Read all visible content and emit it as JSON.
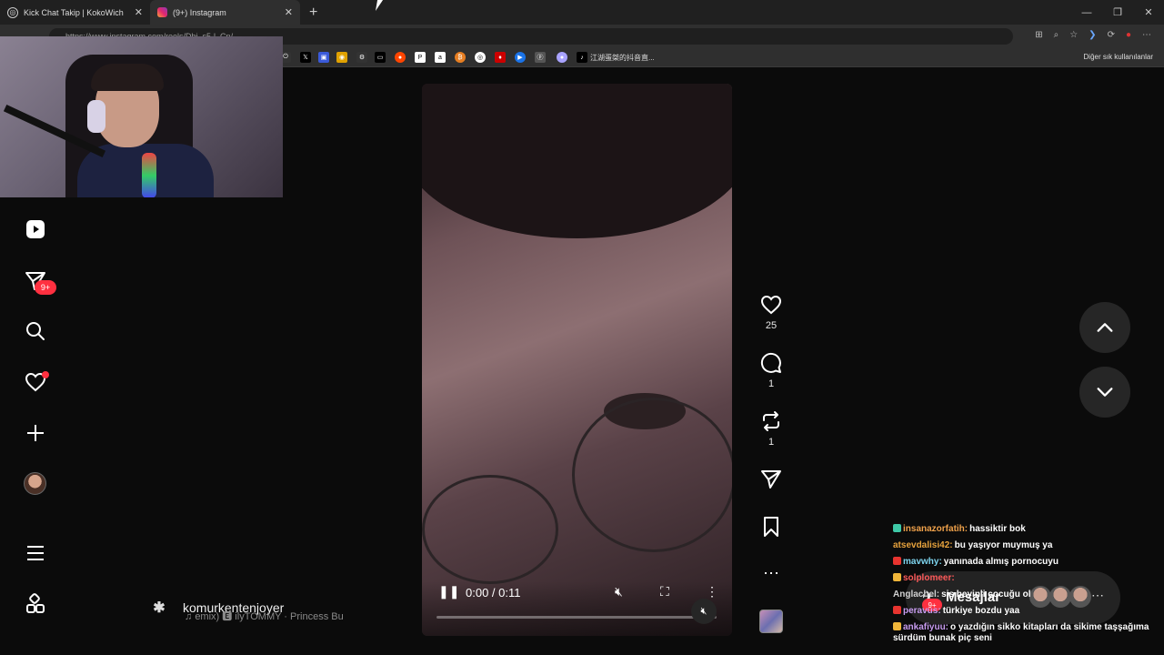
{
  "browser": {
    "tabs": [
      {
        "label": "Kick Chat Takip | KokoWich",
        "active": false
      },
      {
        "label": "(9+) Instagram",
        "active": true
      }
    ],
    "new_tab_label": "+",
    "url": "https://www.instagram.com/reels/Dhi_s5-l_Cn/",
    "bookmark_folder_text": "江湖蛋桀的抖音直...",
    "other_bookmarks": "Diğer sık kullanılanlar"
  },
  "sidebar": {
    "notification_badge": "9+",
    "items": [
      "reels",
      "messages",
      "search",
      "notifications",
      "create",
      "profile",
      "more",
      "also-from-meta"
    ]
  },
  "reel": {
    "author": "komurkentenjoyer",
    "audio": "emix) 🅴 ilyTOMMY · Princess Bu",
    "time": "0:00 / 0:11",
    "progress": 0.0,
    "likes": "25",
    "comments": "1",
    "reposts": "1"
  },
  "chat": {
    "messages": [
      {
        "user": "insanazorfatih:",
        "text": "hassiktir bok",
        "color": "#f0a24b",
        "icon": "#3ec9a7"
      },
      {
        "user": "atsevdalisi42:",
        "text": "bu yaşıyor muymuş ya",
        "color": "#e8a33d",
        "icon": ""
      },
      {
        "user": "mavwhy:",
        "text": "yanınada almış pornocuyu",
        "color": "#7fd6f0",
        "icon": "#e8342f"
      },
      {
        "user": "solplomeer:",
        "text": "",
        "color": "#ff5a5a",
        "icon": "#f0b63a"
      },
      {
        "user": "Anglachel:",
        "text": "sis beyinli çocuğu ol",
        "color": "#d0d0d0",
        "icon": ""
      },
      {
        "user": "peravus:",
        "text": "türkiye bozdu yaa",
        "color": "#c89cf0",
        "icon": "#e8342f"
      },
      {
        "user": "ankafiyuu:",
        "text": "o yazdığın sikko kitapları da sikime taşşağıma sürdüm bunak piç seni",
        "color": "#c89cf0",
        "icon": "#f0b63a"
      }
    ]
  },
  "messages_pill": {
    "label": "Mesajlar",
    "badge": "9+"
  }
}
